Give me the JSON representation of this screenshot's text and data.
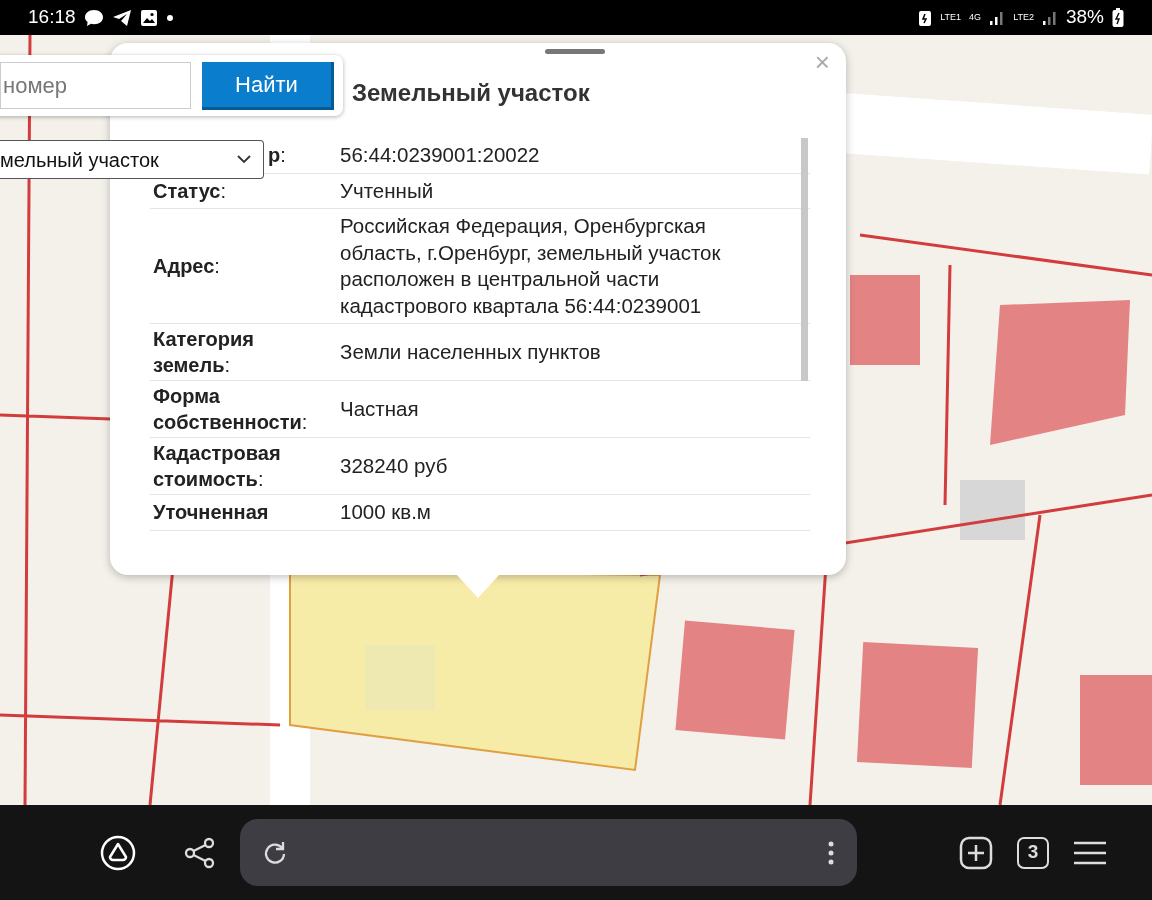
{
  "status_bar": {
    "time": "16:18",
    "sim_1": "LTE1",
    "network": "4G",
    "sim_2": "LTE2",
    "battery": "38%"
  },
  "search": {
    "placeholder": "номер",
    "button": "Найти",
    "object_type": "мельный участок"
  },
  "popup": {
    "title": "Земельный участок",
    "close": "×",
    "rows": [
      {
        "label": "**р**:",
        "value": "56:44:0239001:20022",
        "covered": true
      },
      {
        "label": "**Статус**:",
        "value": "Учтенный"
      },
      {
        "label": "**Адрес**:",
        "value": "Российская Федерация, Оренбургская область, г.Оренбург, земельный участок расположен в центральной части кадастрового квартала 56:44:0239001"
      },
      {
        "label": "**Категория земель**:",
        "value": "Земли населенных пунктов"
      },
      {
        "label": "**Форма собственности**:",
        "value": "Частная"
      },
      {
        "label": "**Кадастровая стоимость**:",
        "value": "328240 руб"
      },
      {
        "label": "**Уточненная**",
        "value": "1000 кв.м"
      }
    ]
  },
  "browser_bar": {
    "tab_count": "3"
  }
}
